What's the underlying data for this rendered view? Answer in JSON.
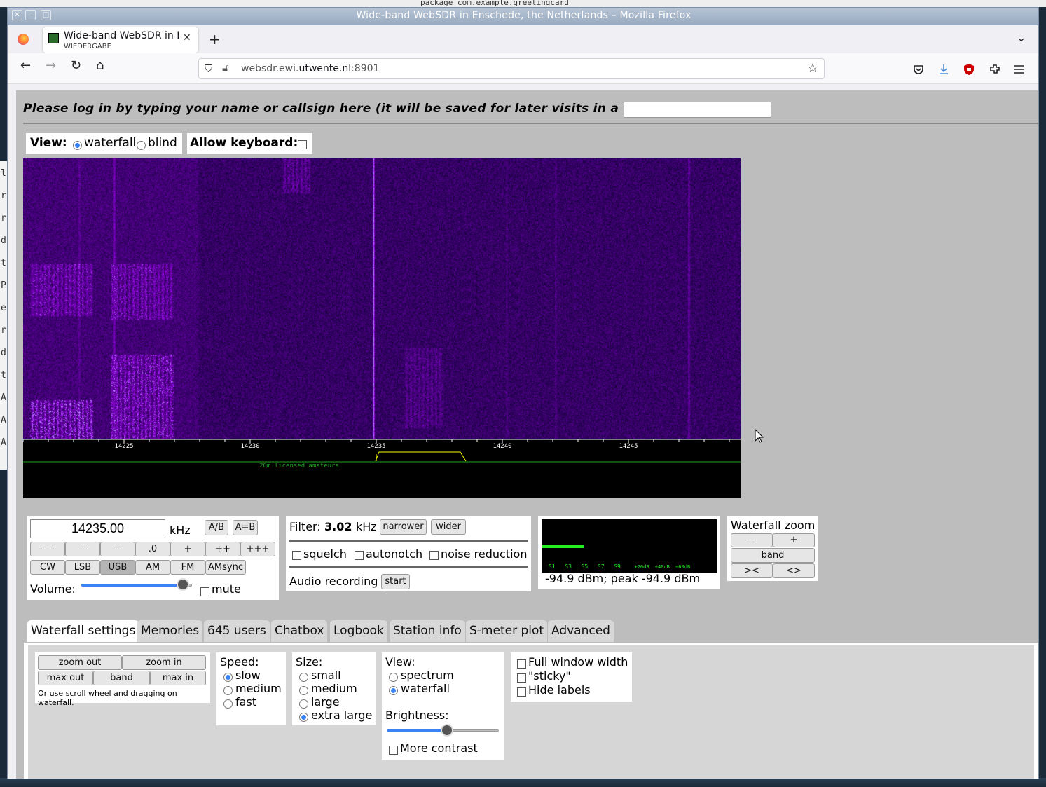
{
  "background": {
    "code_line": "package com.example.greetingcard",
    "sidebar_letters": [
      "l",
      "r",
      "r.",
      "d",
      "t",
      "P",
      "e",
      "r.",
      "d",
      "t",
      "A",
      "A",
      "A"
    ]
  },
  "window": {
    "title": "Wide-band WebSDR in Enschede, the Netherlands – Mozilla Firefox",
    "close": "✕",
    "minimize": "–",
    "maximize": "□"
  },
  "browser": {
    "tab_title": "Wide-band WebSDR in Ens",
    "tab_subtitle": "WIEDERGABE",
    "tab_close": "✕",
    "new_tab": "+",
    "tab_list": "⌄",
    "back": "←",
    "forward": "→",
    "reload": "↻",
    "home": "⌂",
    "url_prefix": "websdr.ewi.",
    "url_host": "utwente.nl",
    "url_suffix": ":8901",
    "bookmark": "☆",
    "toolbar_icons": [
      "pocket-icon",
      "download-icon",
      "ublock-icon",
      "extensions-icon",
      "menu-icon"
    ]
  },
  "login": {
    "prompt": "Please log in by typing your name or callsign here (it will be saved for later visits in a cookie):",
    "value": ""
  },
  "view": {
    "label": "View:",
    "options": [
      "waterfall",
      "blind"
    ],
    "selected": "waterfall"
  },
  "keyboard": {
    "label": "Allow keyboard:",
    "checked": false
  },
  "scale": {
    "ticks": [
      "14225",
      "14230",
      "14235",
      "14240",
      "14245"
    ],
    "band_label": "20m licensed amateurs",
    "colors": {
      "tick": "#ffffff",
      "passband": "#ffff00",
      "band": "#1fa61f"
    }
  },
  "frequency": {
    "value": "14235.00",
    "unit": "kHz",
    "ab": "A/B",
    "a_eq_b": "A=B",
    "step_buttons": [
      "–––",
      "––",
      "–",
      ".0",
      "+",
      "++",
      "+++"
    ],
    "modes": [
      "CW",
      "LSB",
      "USB",
      "AM",
      "FM",
      "AMsync"
    ],
    "selected_mode": "USB",
    "volume_label": "Volume:",
    "volume_level": 0.92,
    "mute_label": "mute",
    "mute": false
  },
  "filter": {
    "label": "Filter:",
    "value": "3.02",
    "unit": "kHz",
    "narrower": "narrower",
    "wider": "wider",
    "options": [
      "squelch",
      "autonotch",
      "noise reduction"
    ],
    "recording_label": "Audio recording",
    "recording_button": "start"
  },
  "smeter": {
    "scale": [
      "S1",
      "S3",
      "S5",
      "S7",
      "S9",
      "+20dB",
      "+40dB",
      "+60dB"
    ],
    "reading": "-94.9 dBm; peak  -94.9 dBm",
    "level_fraction": 0.24,
    "color": "#22ee22"
  },
  "zoom": {
    "title": "Waterfall zoom",
    "minus": "–",
    "plus": "+",
    "band": "band",
    "narrow": "><",
    "wide": "<>"
  },
  "tabs": [
    "Waterfall settings",
    "Memories",
    "645 users",
    "Chatbox",
    "Logbook",
    "Station info",
    "S-meter plot",
    "Advanced"
  ],
  "active_tab": "Waterfall settings",
  "waterfall_settings": {
    "zoom_out": "zoom out",
    "zoom_in": "zoom in",
    "max_out": "max out",
    "band": "band",
    "max_in": "max in",
    "hint": "Or use scroll wheel and dragging on waterfall.",
    "speed_label": "Speed:",
    "speed_options": [
      "slow",
      "medium",
      "fast"
    ],
    "speed_selected": "slow",
    "size_label": "Size:",
    "size_options": [
      "small",
      "medium",
      "large",
      "extra large"
    ],
    "size_selected": "extra large",
    "view_label": "View:",
    "view_options": [
      "spectrum",
      "waterfall"
    ],
    "view_selected": "waterfall",
    "brightness_label": "Brightness:",
    "brightness_level": 0.54,
    "more_contrast": "More contrast",
    "checkboxes": [
      "Full window width",
      "\"sticky\"",
      "Hide labels"
    ]
  }
}
